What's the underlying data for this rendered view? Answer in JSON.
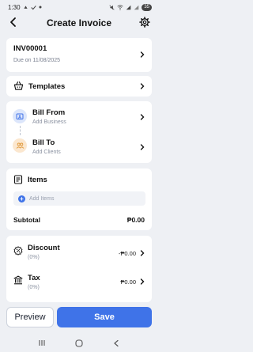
{
  "status_bar": {
    "time": "1:30",
    "battery": "35"
  },
  "header": {
    "title": "Create Invoice"
  },
  "invoice": {
    "number": "INV00001",
    "due": "Due on 11/08/2025"
  },
  "templates": {
    "label": "Templates"
  },
  "bill_from": {
    "label": "Bill From",
    "sub": "Add Business"
  },
  "bill_to": {
    "label": "Bill To",
    "sub": "Add Clients"
  },
  "items": {
    "label": "Items",
    "add_label": "Add Items",
    "subtotal_label": "Subtotal",
    "subtotal_value": "₱0.00"
  },
  "discount": {
    "label": "Discount",
    "sub": "(0%)",
    "value": "-₱0.00"
  },
  "tax": {
    "label": "Tax",
    "sub": "(0%)",
    "value": "₱0.00"
  },
  "actions": {
    "preview": "Preview",
    "save": "Save"
  },
  "colors": {
    "accent": "#3f73e8",
    "background": "#eef0f4",
    "bill_from_circle": "#dce6fb",
    "bill_to_circle": "#fbe7cf"
  }
}
